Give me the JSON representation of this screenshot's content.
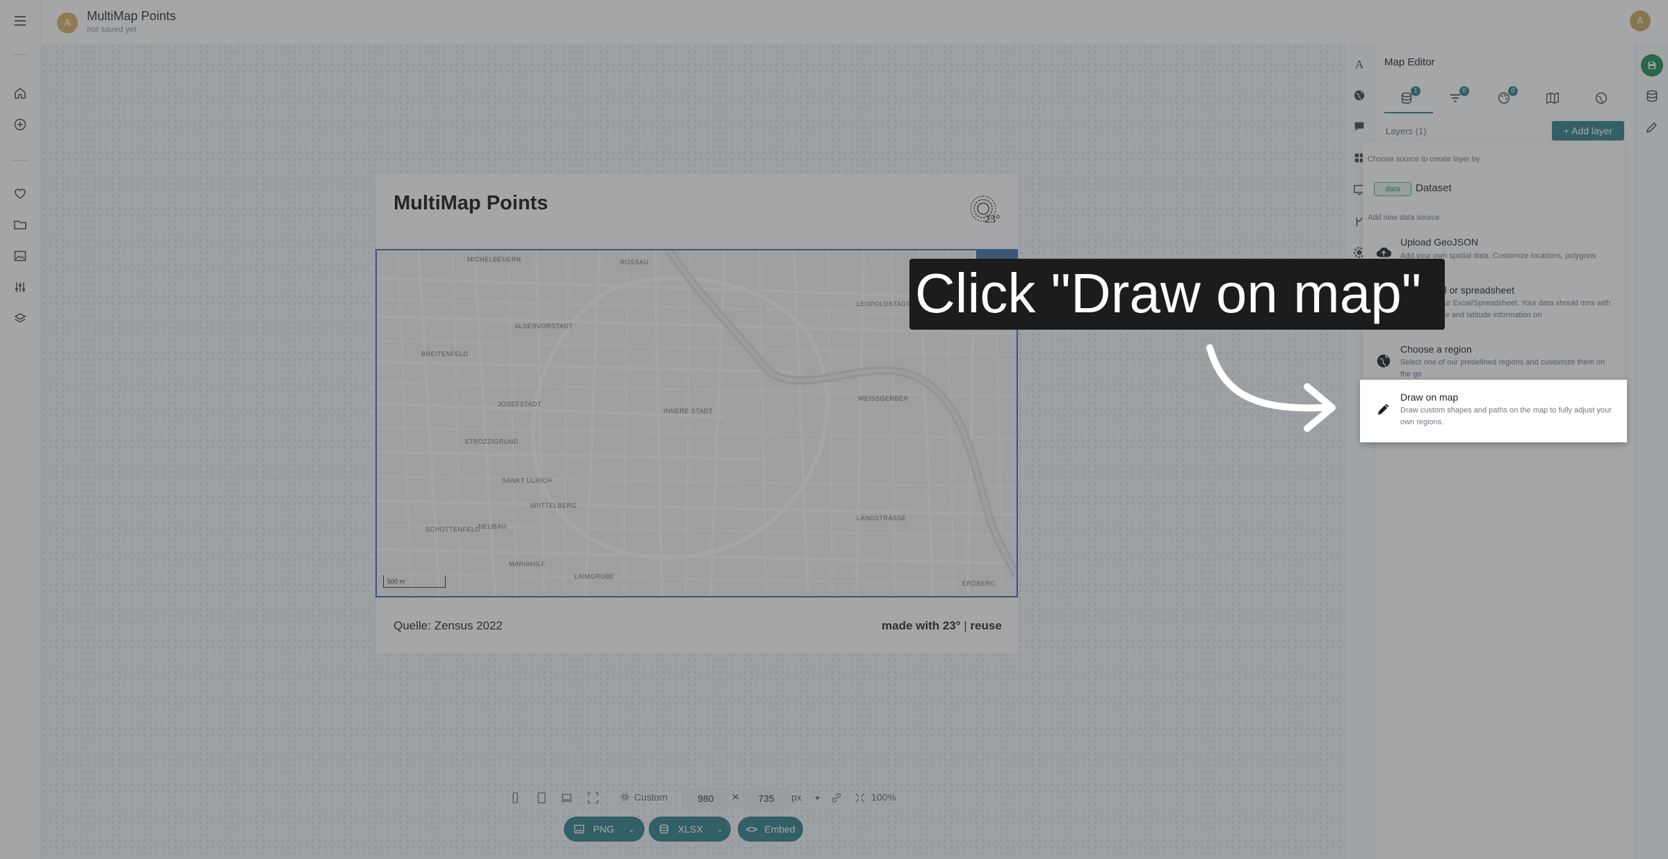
{
  "app": {
    "title": "MultiMap Points",
    "subtitle": "not saved yet",
    "avatar_initial": "A",
    "user_initial": "A"
  },
  "colors": {
    "accent": "#2f7d87",
    "save": "#1e8a4e",
    "map_border": "#3b6ea8"
  },
  "left_rail": {
    "icons": [
      "menu-icon",
      "home-icon",
      "add-circle-icon",
      "heart-icon",
      "folder-icon",
      "image-icon",
      "sliders-icon",
      "layers-icon"
    ]
  },
  "map_card": {
    "title": "MultiMap Points",
    "logo_text": "23°",
    "source": "Quelle: Zensus 2022",
    "made_with": "made with 23°",
    "made_with_sep": " | ",
    "reuse": "reuse",
    "scale": "500 m",
    "labels": [
      "MICHELBEUERN",
      "ROSSAU",
      "LEOPOLDSTADT",
      "ALSERVORSTADT",
      "BREITENFELD",
      "JOSEFSTADT",
      "INNERE STADT",
      "WEISSGERBER",
      "STROZZIGRUND",
      "SANKT ULRICH",
      "SPITTELBERG",
      "SCHOTTENFELD",
      "NEUBAU",
      "LANDSTRASSE",
      "MARIAHILF",
      "LAIMGRUBE",
      "ERDBERG"
    ]
  },
  "toolbar": {
    "preset": "Custom",
    "width": "980",
    "height": "735",
    "times": "×",
    "unit": "px",
    "zoom": "100%",
    "png": "PNG",
    "xlsx": "XLSX",
    "embed": "Embed"
  },
  "editor": {
    "title": "Map Editor",
    "tab_badges": [
      "1",
      "0",
      "0"
    ],
    "layers_label": "Layers (1)",
    "add_layer": "+ Add layer"
  },
  "dropdown": {
    "caption_source": "Choose source to create layer by",
    "chip": "data",
    "dataset": "Dataset",
    "caption_new": "Add new data source",
    "items": [
      {
        "title": "Upload GeoJSON",
        "desc": "Add your own spatial data. Customize locations, polygons"
      },
      {
        "title": "excel or spreadsheet",
        "desc": "from your Excel/Spreadsheet. Your data should mns with longitude and latitude information on"
      },
      {
        "title": "Choose a region",
        "desc": "Select one of our predefined regions and customize them on the go"
      },
      {
        "title": "Draw on map",
        "desc": "Draw custom shapes and paths on the map to fully adjust your own regions."
      }
    ]
  },
  "callout": {
    "text": "Click \"Draw on map\""
  }
}
